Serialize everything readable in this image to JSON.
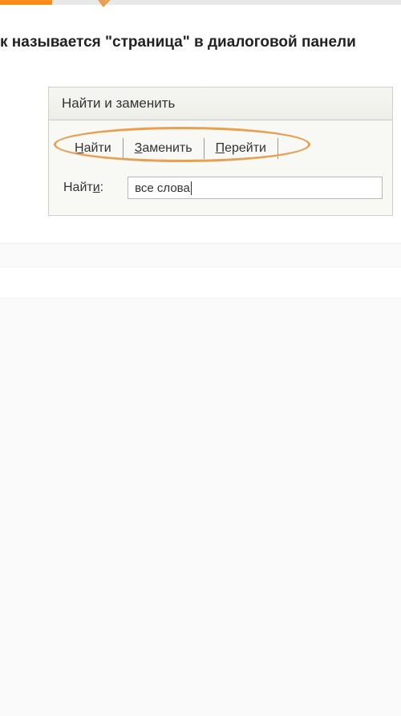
{
  "progress": {
    "percent": 13
  },
  "question": {
    "text": "к называется \"страница\" в диалоговой панели"
  },
  "dialog": {
    "title": "Найти и заменить",
    "tabs": [
      {
        "label": "Найти",
        "underline_index": 0
      },
      {
        "label": "Заменить",
        "underline_index": 0
      },
      {
        "label": "Перейти",
        "underline_index": 0
      }
    ],
    "find_label": "Найти:",
    "find_label_underline": "и",
    "find_value": "все слова"
  }
}
